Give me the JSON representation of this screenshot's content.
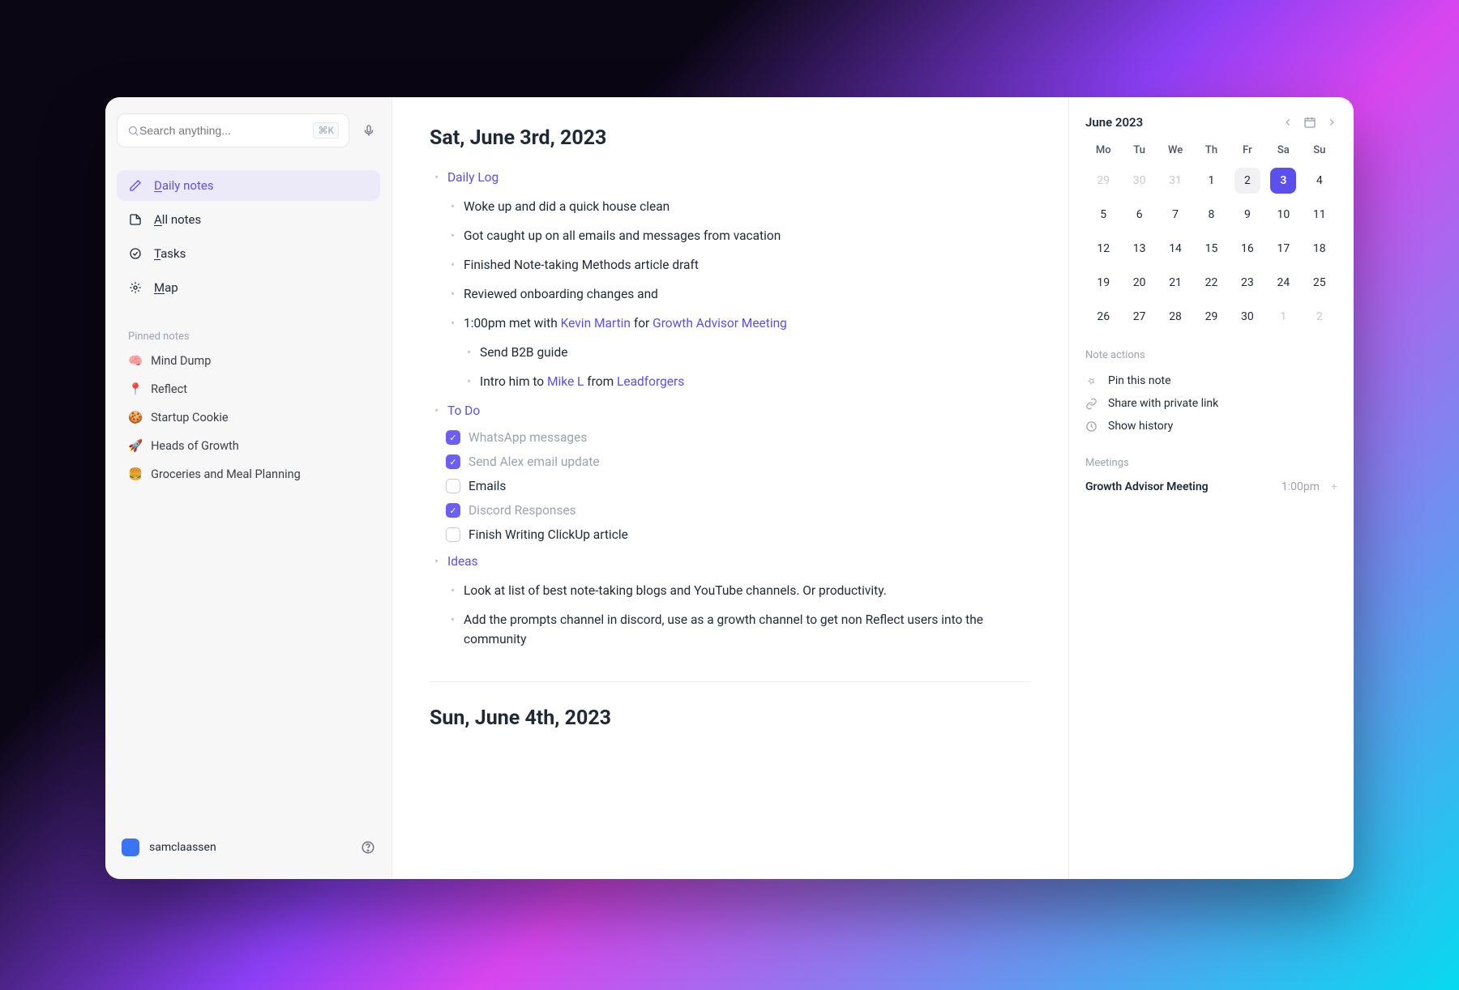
{
  "search": {
    "placeholder": "Search anything...",
    "shortcut": "⌘K"
  },
  "nav": {
    "daily": "Daily notes",
    "all": "All notes",
    "tasks": "Tasks",
    "map": "Map"
  },
  "pinned_label": "Pinned notes",
  "pinned": [
    {
      "emoji": "🧠",
      "label": "Mind Dump"
    },
    {
      "emoji": "📍",
      "label": "Reflect"
    },
    {
      "emoji": "🍪",
      "label": "Startup Cookie"
    },
    {
      "emoji": "🚀",
      "label": "Heads of Growth"
    },
    {
      "emoji": "🍔",
      "label": "Groceries and Meal Planning"
    }
  ],
  "user": {
    "name": "samclaassen"
  },
  "note1": {
    "title": "Sat, June 3rd, 2023",
    "daily_log_label": "Daily Log",
    "log": [
      "Woke up and did a quick house clean",
      "Got caught up on all emails and messages from vacation",
      "Finished Note-taking Methods article draft",
      "Reviewed onboarding changes and"
    ],
    "meeting_line": {
      "prefix": "1:00pm met with ",
      "person": "Kevin Martin",
      "mid": " for ",
      "event": "Growth Advisor Meeting"
    },
    "meeting_sub": [
      "Send B2B guide"
    ],
    "intro_line": {
      "prefix": "Intro him to ",
      "person": "Mike L",
      "mid": " from ",
      "company": "Leadforgers"
    },
    "todo_label": "To Do",
    "todos": [
      {
        "done": true,
        "label": "WhatsApp messages"
      },
      {
        "done": true,
        "label": "Send Alex email update"
      },
      {
        "done": false,
        "label": "Emails"
      },
      {
        "done": true,
        "label": "Discord Responses"
      },
      {
        "done": false,
        "label": "Finish Writing ClickUp article"
      }
    ],
    "ideas_label": "Ideas",
    "ideas": [
      "Look at list of best note-taking blogs and YouTube channels. Or productivity.",
      "Add the prompts channel in discord, use as a growth channel to get non Reflect users into the community"
    ]
  },
  "note2": {
    "title": "Sun, June 4th, 2023"
  },
  "calendar": {
    "title": "June 2023",
    "dow": [
      "Mo",
      "Tu",
      "We",
      "Th",
      "Fr",
      "Sa",
      "Su"
    ],
    "days": [
      {
        "n": 29,
        "muted": true
      },
      {
        "n": 30,
        "muted": true
      },
      {
        "n": 31,
        "muted": true
      },
      {
        "n": 1
      },
      {
        "n": 2,
        "hov": true
      },
      {
        "n": 3,
        "sel": true
      },
      {
        "n": 4
      },
      {
        "n": 5
      },
      {
        "n": 6
      },
      {
        "n": 7
      },
      {
        "n": 8
      },
      {
        "n": 9
      },
      {
        "n": 10
      },
      {
        "n": 11
      },
      {
        "n": 12
      },
      {
        "n": 13
      },
      {
        "n": 14
      },
      {
        "n": 15
      },
      {
        "n": 16
      },
      {
        "n": 17
      },
      {
        "n": 18
      },
      {
        "n": 19
      },
      {
        "n": 20
      },
      {
        "n": 21
      },
      {
        "n": 22
      },
      {
        "n": 23
      },
      {
        "n": 24
      },
      {
        "n": 25
      },
      {
        "n": 26
      },
      {
        "n": 27
      },
      {
        "n": 28
      },
      {
        "n": 29
      },
      {
        "n": 30
      },
      {
        "n": 1,
        "muted": true
      },
      {
        "n": 2,
        "muted": true
      }
    ]
  },
  "actions_label": "Note actions",
  "actions": {
    "pin": "Pin this note",
    "share": "Share with private link",
    "history": "Show history"
  },
  "meetings_label": "Meetings",
  "meeting": {
    "name": "Growth Advisor Meeting",
    "time": "1:00pm"
  }
}
